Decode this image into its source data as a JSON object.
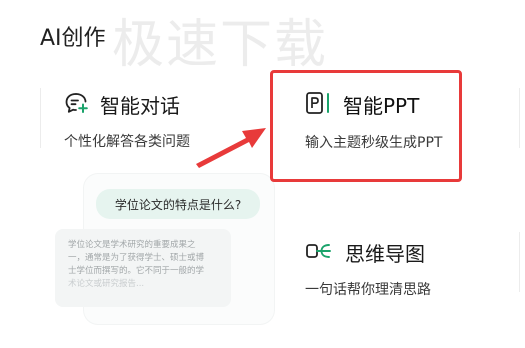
{
  "watermark": "极速下载",
  "section": {
    "title": "AI创作"
  },
  "cards": {
    "chat": {
      "icon": "chat-bubble-plus-icon",
      "title": "智能对话",
      "subtitle": "个性化解答各类问题"
    },
    "ppt": {
      "icon": "ppt-document-icon",
      "title": "智能PPT",
      "subtitle": "输入主题秒级生成PPT"
    },
    "mind": {
      "icon": "mind-map-icon",
      "title": "思维导图",
      "subtitle": "一句话帮你理清思路"
    }
  },
  "preview": {
    "question": "学位论文的特点是什么?",
    "answer_lines": [
      "学位论文是学术研究的重要成果之",
      "一，通常是为了获得学士、硕士或博",
      "士学位而撰写的。它不同于一般的学",
      "术论文或研究报告..."
    ]
  },
  "colors": {
    "highlight": "#e83a3a",
    "accent_green": "#1aa36b",
    "bubble_bg": "#e6f4ef"
  }
}
